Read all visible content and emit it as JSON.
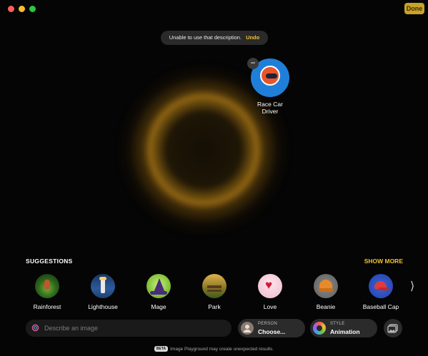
{
  "window": {
    "done_label": "Done"
  },
  "toast": {
    "message": "Unable to use that description.",
    "action": "Undo"
  },
  "concept": {
    "label_line1": "Race Car",
    "label_line2": "Driver",
    "icon": "race-car-helmet-icon"
  },
  "suggestions": {
    "header": "SUGGESTIONS",
    "show_more": "SHOW MORE",
    "items": [
      {
        "label": "Rainforest",
        "icon": "rainforest-thumb"
      },
      {
        "label": "Lighthouse",
        "icon": "lighthouse-thumb"
      },
      {
        "label": "Mage",
        "icon": "mage-hat-thumb"
      },
      {
        "label": "Park",
        "icon": "park-bench-thumb"
      },
      {
        "label": "Love",
        "icon": "heart-balloon-thumb"
      },
      {
        "label": "Beanie",
        "icon": "beanie-thumb"
      },
      {
        "label": "Baseball Cap",
        "icon": "baseball-cap-thumb"
      }
    ]
  },
  "input": {
    "placeholder": "Describe an image"
  },
  "person": {
    "caption": "PERSON",
    "value": "Choose..."
  },
  "style": {
    "caption": "STYLE",
    "value": "Animation"
  },
  "footer": {
    "badge": "BETA",
    "text": "Image Playground may create unexpected results."
  },
  "colors": {
    "accent": "#f2c230",
    "done_bg": "#c9a227",
    "background": "#050505"
  }
}
